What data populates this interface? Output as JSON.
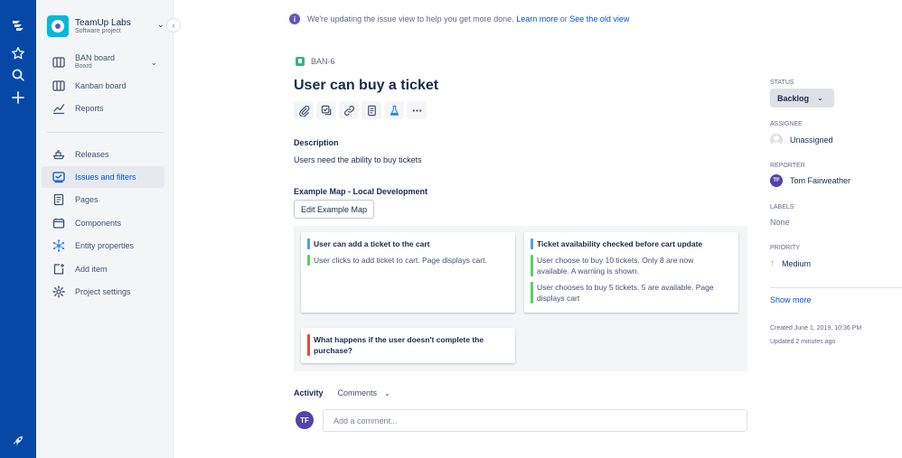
{
  "rail": {
    "icons": [
      "jira-logo-icon",
      "star-icon",
      "search-icon",
      "plus-icon",
      "rocket-icon"
    ]
  },
  "sidebar": {
    "project_name": "TeamUp Labs",
    "project_type": "Software project",
    "board_label": "BAN board",
    "board_sub": "Board",
    "items": [
      {
        "label": "Kanban board"
      },
      {
        "label": "Reports"
      },
      {
        "label": "Releases"
      },
      {
        "label": "Issues and filters"
      },
      {
        "label": "Pages"
      },
      {
        "label": "Components"
      },
      {
        "label": "Entity properties"
      },
      {
        "label": "Add item"
      },
      {
        "label": "Project settings"
      }
    ],
    "active": "Issues and filters"
  },
  "banner": {
    "text": "We're updating the issue view to help you get more done.",
    "learn_more": "Learn more",
    "or": "or",
    "old_view": "See the old view"
  },
  "issue": {
    "key": "BAN-6",
    "title": "User can buy a ticket",
    "description_label": "Description",
    "description": "Users need the ability to buy tickets",
    "example_map_label": "Example Map - Local Development",
    "edit_button": "Edit Example Map"
  },
  "example_map": {
    "cards": [
      {
        "rule": "User can add a ticket to the cart",
        "examples": [
          "User clicks to add ticket to cart. Page displays cart."
        ]
      },
      {
        "rule": "Ticket availability checked before cart update",
        "examples": [
          "User choose to buy 10 tickets. Only 8 are now available. A warning is shown.",
          "User chooses to buy 5 tickets. 5 are available. Page displays cart"
        ]
      },
      {
        "question": "What happens if the user doesn't complete the purchase?"
      }
    ],
    "colors": {
      "rule": "#4aa3df",
      "example": "#57d163",
      "question": "#e5493a"
    }
  },
  "activity": {
    "label": "Activity",
    "filter": "Comments",
    "avatar_initials": "TF",
    "comment_placeholder": "Add a comment..."
  },
  "details": {
    "status_label": "STATUS",
    "status_value": "Backlog",
    "assignee_label": "ASSIGNEE",
    "assignee_value": "Unassigned",
    "reporter_label": "REPORTER",
    "reporter_initials": "TF",
    "reporter_value": "Tom Fairweather",
    "labels_label": "LABELS",
    "labels_value": "None",
    "priority_label": "PRIORITY",
    "priority_value": "Medium",
    "show_more": "Show more",
    "created": "Created June 1, 2019, 10:36 PM",
    "updated": "Updated 2 minutes ago"
  }
}
